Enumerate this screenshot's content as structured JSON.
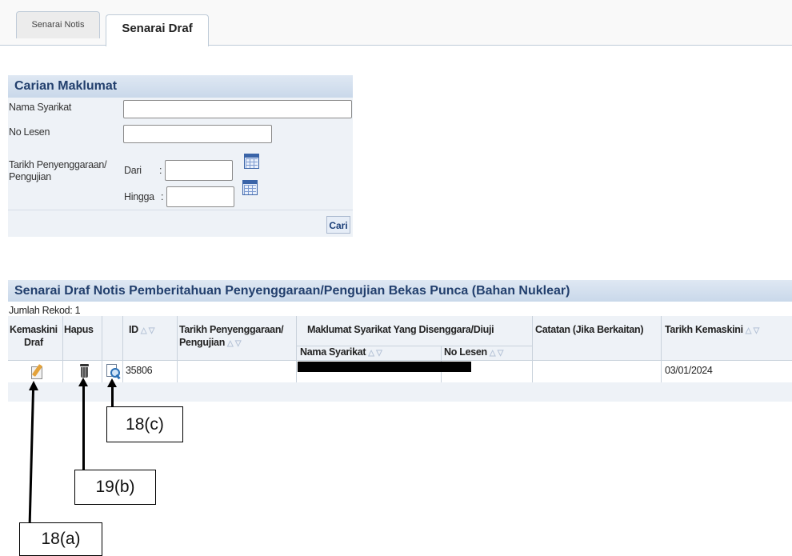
{
  "tabs": [
    {
      "label": "Senarai Notis",
      "active": false
    },
    {
      "label": "Senarai Draf",
      "active": true
    }
  ],
  "search": {
    "title": "Carian Maklumat",
    "fields": {
      "nama_syarikat": {
        "label": "Nama Syarikat",
        "value": ""
      },
      "no_lesen": {
        "label": "No Lesen",
        "value": ""
      },
      "tarikh": {
        "label_line1": "Tarikh Penyenggaraan/",
        "label_line2": "Pengujian"
      },
      "dari": {
        "label": "Dari",
        "sep": ":",
        "value": ""
      },
      "hingga": {
        "label": "Hingga",
        "sep": ":",
        "value": ""
      }
    },
    "button": "Cari"
  },
  "results": {
    "title": "Senarai Draf Notis Pemberitahuan Penyenggaraan/Pengujian Bekas Punca (Bahan Nuklear)",
    "record_count": "Jumlah Rekod: 1",
    "headers": {
      "kemaskini_1": "Kemaskini",
      "kemaskini_2": "Draf",
      "hapus": "Hapus",
      "id": "ID",
      "tarikh_1": "Tarikh Penyenggaraan/",
      "tarikh_2": "Pengujian",
      "maklumat": "Maklumat Syarikat Yang Disenggara/Diuji",
      "nama_syarikat": "Nama Syarikat",
      "no_lesen": "No Lesen",
      "catatan": "Catatan (Jika Berkaitan)",
      "tarikh_kemaskini": "Tarikh Kemaskini"
    },
    "sort_arrows": "△ ▽",
    "rows": [
      {
        "id": "35806",
        "tarikh_kemaskini": "03/01/2024"
      }
    ]
  },
  "annotations": [
    "18(c)",
    "19(b)",
    "18(a)"
  ],
  "icons": [
    "calendar-icon",
    "edit-pencil-icon",
    "trash-bin-icon",
    "view-magnifier-icon"
  ],
  "colors": {
    "accent": "#223f6d",
    "header_band": "#c9d8ea",
    "panel_bg": "#eef2f7"
  }
}
